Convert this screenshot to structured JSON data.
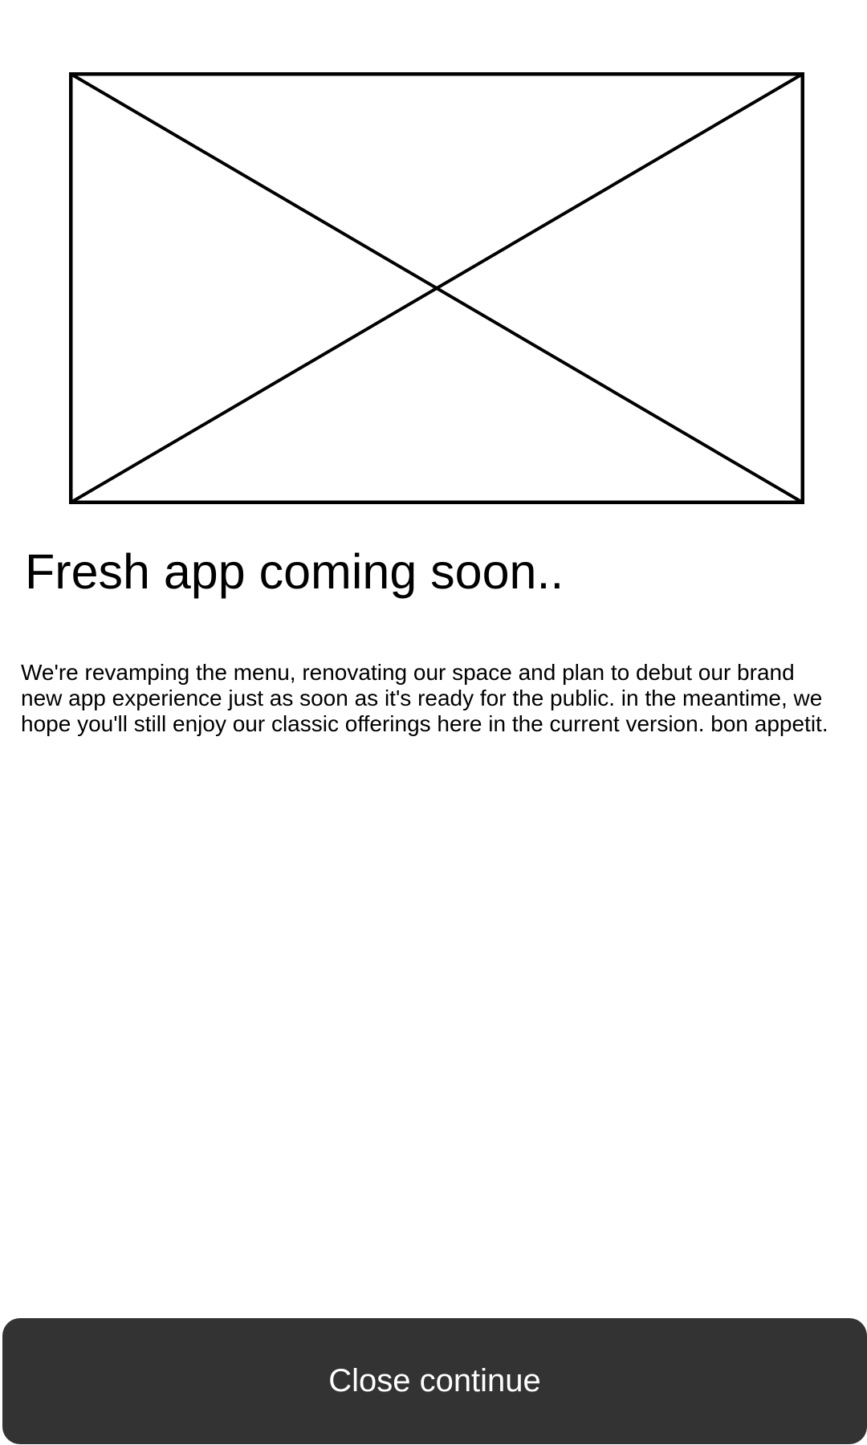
{
  "hero_image": {
    "icon": "image-placeholder-icon"
  },
  "headline": "Fresh app coming soon..",
  "body": "We're revamping the menu, renovating our space and plan to debut our brand new app experience just as soon as it's ready for the public. in the meantime, we hope you'll still enjoy our classic offerings here in the current version. bon appetit.",
  "close_button": {
    "label": "Close continue",
    "background": "#333333",
    "text_color": "#ffffff"
  }
}
